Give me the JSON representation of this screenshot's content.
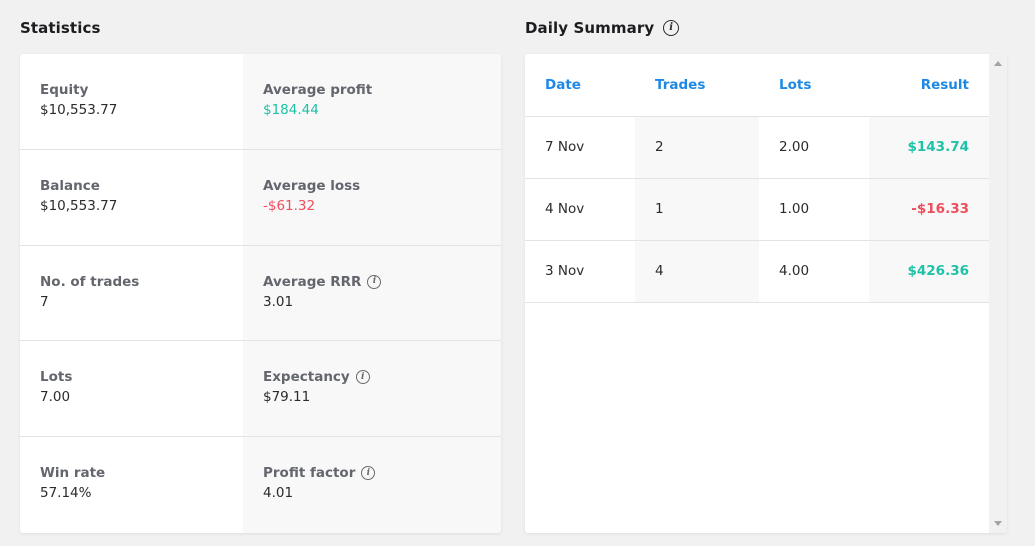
{
  "statistics": {
    "title": "Statistics",
    "cells": [
      {
        "label": "Equity",
        "value": "$10,553.77",
        "info": false
      },
      {
        "label": "Average profit",
        "value": "$184.44",
        "info": false,
        "tone": "positive"
      },
      {
        "label": "Balance",
        "value": "$10,553.77",
        "info": false
      },
      {
        "label": "Average loss",
        "value": "-$61.32",
        "info": false,
        "tone": "negative"
      },
      {
        "label": "No. of trades",
        "value": "7",
        "info": false
      },
      {
        "label": "Average RRR",
        "value": "3.01",
        "info": true
      },
      {
        "label": "Lots",
        "value": "7.00",
        "info": false
      },
      {
        "label": "Expectancy",
        "value": "$79.11",
        "info": true
      },
      {
        "label": "Win rate",
        "value": "57.14%",
        "info": false
      },
      {
        "label": "Profit factor",
        "value": "4.01",
        "info": true
      }
    ]
  },
  "daily_summary": {
    "title": "Daily Summary",
    "info_icon": "info-icon",
    "columns": [
      "Date",
      "Trades",
      "Lots",
      "Result"
    ],
    "rows": [
      {
        "date": "7 Nov",
        "trades": "2",
        "lots": "2.00",
        "result": "$143.74",
        "tone": "positive"
      },
      {
        "date": "4 Nov",
        "trades": "1",
        "lots": "1.00",
        "result": "-$16.33",
        "tone": "negative"
      },
      {
        "date": "3 Nov",
        "trades": "4",
        "lots": "4.00",
        "result": "$426.36",
        "tone": "positive"
      }
    ]
  },
  "colors": {
    "positive": "#1ec2a7",
    "negative": "#f04d5c",
    "header_accent": "#1e88e5"
  }
}
